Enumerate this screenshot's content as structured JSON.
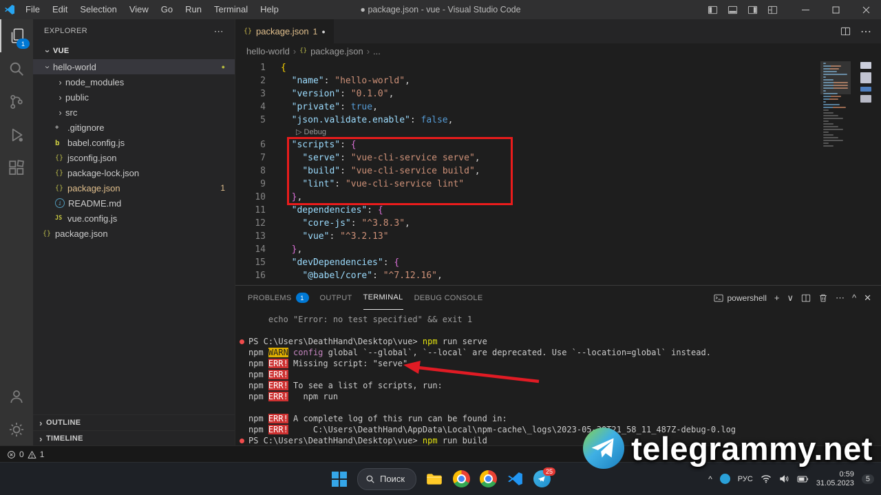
{
  "title_bar": {
    "menus": [
      "File",
      "Edit",
      "Selection",
      "View",
      "Go",
      "Run",
      "Terminal",
      "Help"
    ],
    "title": "● package.json - vue - Visual Studio Code"
  },
  "activity_bar": {
    "explorer_badge": "1"
  },
  "sidebar": {
    "header": "EXPLORER",
    "section_label": "VUE",
    "files": [
      {
        "name": "hello-world",
        "kind": "folder",
        "open": true,
        "level": 0,
        "selected": true,
        "dot": "●"
      },
      {
        "name": "node_modules",
        "kind": "folder",
        "level": 1
      },
      {
        "name": "public",
        "kind": "folder",
        "level": 1
      },
      {
        "name": "src",
        "kind": "folder",
        "level": 1
      },
      {
        "name": ".gitignore",
        "kind": "file",
        "icon": "gitignore",
        "level": 1
      },
      {
        "name": "babel.config.js",
        "kind": "file",
        "icon": "babel",
        "level": 1
      },
      {
        "name": "jsconfig.json",
        "kind": "file",
        "icon": "json",
        "level": 1
      },
      {
        "name": "package-lock.json",
        "kind": "file",
        "icon": "json",
        "level": 1
      },
      {
        "name": "package.json",
        "kind": "file",
        "icon": "json",
        "level": 1,
        "modified": true,
        "badge": "1"
      },
      {
        "name": "README.md",
        "kind": "file",
        "icon": "info",
        "level": 1
      },
      {
        "name": "vue.config.js",
        "kind": "file",
        "icon": "js",
        "level": 1
      },
      {
        "name": "package.json",
        "kind": "file",
        "icon": "json",
        "level": 0
      }
    ],
    "outline_label": "OUTLINE",
    "timeline_label": "TIMELINE"
  },
  "editor": {
    "tab": {
      "icon": "{}",
      "label": "package.json",
      "badge": "1",
      "dirty": "●"
    },
    "breadcrumb": {
      "folder": "hello-world",
      "file_icon": "{}",
      "file": "package.json",
      "more": "..."
    },
    "codelens": "Debug",
    "code_lines": [
      {
        "n": "1",
        "s": [
          [
            "b1",
            "{"
          ]
        ]
      },
      {
        "n": "2",
        "s": [
          [
            "p",
            "  "
          ],
          [
            "k",
            "\"name\""
          ],
          [
            "p",
            ": "
          ],
          [
            "s",
            "\"hello-world\""
          ],
          [
            "p",
            ","
          ]
        ]
      },
      {
        "n": "3",
        "s": [
          [
            "p",
            "  "
          ],
          [
            "k",
            "\"version\""
          ],
          [
            "p",
            ": "
          ],
          [
            "s",
            "\"0.1.0\""
          ],
          [
            "p",
            ","
          ]
        ]
      },
      {
        "n": "4",
        "s": [
          [
            "p",
            "  "
          ],
          [
            "k",
            "\"private\""
          ],
          [
            "p",
            ": "
          ],
          [
            "v",
            "true"
          ],
          [
            "p",
            ","
          ]
        ]
      },
      {
        "n": "5",
        "s": [
          [
            "p",
            "  "
          ],
          [
            "k",
            "\"json.validate.enable\""
          ],
          [
            "p",
            ": "
          ],
          [
            "v",
            "false"
          ],
          [
            "p",
            ","
          ]
        ]
      },
      {
        "lens": true
      },
      {
        "n": "6",
        "s": [
          [
            "p",
            "  "
          ],
          [
            "k",
            "\"scripts\""
          ],
          [
            "p",
            ": "
          ],
          [
            "b2",
            "{"
          ]
        ]
      },
      {
        "n": "7",
        "s": [
          [
            "p",
            "    "
          ],
          [
            "k",
            "\"serve\""
          ],
          [
            "p",
            ": "
          ],
          [
            "s",
            "\"vue-cli-service serve\""
          ],
          [
            "p",
            ","
          ]
        ]
      },
      {
        "n": "8",
        "s": [
          [
            "p",
            "    "
          ],
          [
            "k",
            "\"build\""
          ],
          [
            "p",
            ": "
          ],
          [
            "s",
            "\"vue-cli-service build\""
          ],
          [
            "p",
            ","
          ]
        ]
      },
      {
        "n": "9",
        "s": [
          [
            "p",
            "    "
          ],
          [
            "k",
            "\"lint\""
          ],
          [
            "p",
            ": "
          ],
          [
            "s",
            "\"vue-cli-service lint\""
          ]
        ]
      },
      {
        "n": "10",
        "s": [
          [
            "p",
            "  "
          ],
          [
            "b2",
            "}"
          ],
          [
            "p",
            ","
          ]
        ]
      },
      {
        "n": "11",
        "s": [
          [
            "p",
            "  "
          ],
          [
            "k",
            "\"dependencies\""
          ],
          [
            "p",
            ": "
          ],
          [
            "b2",
            "{"
          ]
        ]
      },
      {
        "n": "12",
        "s": [
          [
            "p",
            "    "
          ],
          [
            "k",
            "\"core-js\""
          ],
          [
            "p",
            ": "
          ],
          [
            "s",
            "\"^3.8.3\""
          ],
          [
            "p",
            ","
          ]
        ]
      },
      {
        "n": "13",
        "s": [
          [
            "p",
            "    "
          ],
          [
            "k",
            "\"vue\""
          ],
          [
            "p",
            ": "
          ],
          [
            "s",
            "\"^3.2.13\""
          ]
        ]
      },
      {
        "n": "14",
        "s": [
          [
            "p",
            "  "
          ],
          [
            "b2",
            "}"
          ],
          [
            "p",
            ","
          ]
        ]
      },
      {
        "n": "15",
        "s": [
          [
            "p",
            "  "
          ],
          [
            "k",
            "\"devDependencies\""
          ],
          [
            "p",
            ": "
          ],
          [
            "b2",
            "{"
          ]
        ]
      },
      {
        "n": "16",
        "s": [
          [
            "p",
            "    "
          ],
          [
            "k",
            "\"@babel/core\""
          ],
          [
            "p",
            ": "
          ],
          [
            "s",
            "\"^7.12.16\""
          ],
          [
            "p",
            ","
          ]
        ]
      }
    ]
  },
  "panel": {
    "tabs": [
      {
        "label": "PROBLEMS",
        "badge": "1"
      },
      {
        "label": "OUTPUT"
      },
      {
        "label": "TERMINAL",
        "active": true
      },
      {
        "label": "DEBUG CONSOLE"
      }
    ],
    "shell_label": "powershell",
    "terminal_lines": [
      {
        "s": [
          [
            "dim",
            "    echo \"Error: no test specified\" && exit 1"
          ]
        ]
      },
      {
        "s": []
      },
      {
        "mark": true,
        "s": [
          [
            "w",
            "PS C:\\Users\\DeathHand\\Desktop\\vue> "
          ],
          [
            "cmd",
            "npm"
          ],
          [
            "w",
            " run serve"
          ]
        ]
      },
      {
        "s": [
          [
            "w",
            "npm "
          ],
          [
            "warnb",
            "WARN"
          ],
          [
            "w",
            " "
          ],
          [
            "mag",
            "config"
          ],
          [
            "w",
            " global `--global`, `--local` are deprecated. Use `--location=global` instead."
          ]
        ]
      },
      {
        "s": [
          [
            "w",
            "npm "
          ],
          [
            "errb",
            "ERR!"
          ],
          [
            "w",
            " Missing script: \"serve\""
          ]
        ]
      },
      {
        "s": [
          [
            "w",
            "npm "
          ],
          [
            "errb",
            "ERR!"
          ]
        ]
      },
      {
        "s": [
          [
            "w",
            "npm "
          ],
          [
            "errb",
            "ERR!"
          ],
          [
            "w",
            " To see a list of scripts, run:"
          ]
        ]
      },
      {
        "s": [
          [
            "w",
            "npm "
          ],
          [
            "errb",
            "ERR!"
          ],
          [
            "w",
            "   npm run"
          ]
        ]
      },
      {
        "s": []
      },
      {
        "s": [
          [
            "w",
            "npm "
          ],
          [
            "errb",
            "ERR!"
          ],
          [
            "w",
            " A complete log of this run can be found in:"
          ]
        ]
      },
      {
        "s": [
          [
            "w",
            "npm "
          ],
          [
            "errb",
            "ERR!"
          ],
          [
            "w",
            "     C:\\Users\\DeathHand\\AppData\\Local\\npm-cache\\_logs\\2023-05-30T21_58_11_487Z-debug-0.log"
          ]
        ]
      },
      {
        "mark": true,
        "s": [
          [
            "w",
            "PS C:\\Users\\DeathHand\\Desktop\\vue> "
          ],
          [
            "cmd",
            "npm"
          ],
          [
            "w",
            " run build"
          ]
        ]
      }
    ]
  },
  "status_bar": {
    "errors": "0",
    "warnings": "1"
  },
  "taskbar": {
    "search_label": "Поиск",
    "language": "РУС",
    "time": "0:59",
    "date": "31.05.2023",
    "notification_count": "5",
    "telegram_badge": "25"
  },
  "watermark": {
    "text": "telegrammy.net"
  }
}
